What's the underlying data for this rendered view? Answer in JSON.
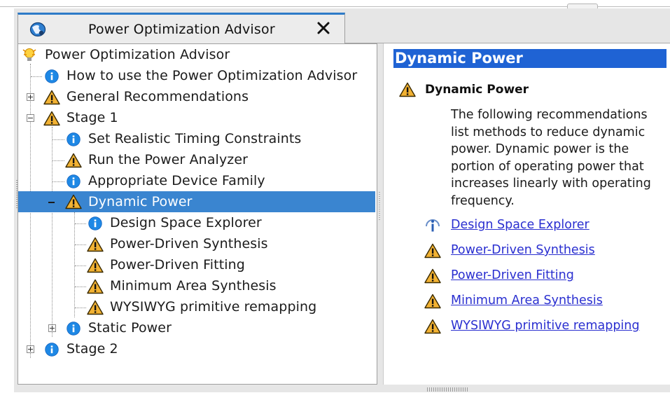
{
  "tab": {
    "title": "Power Optimization Advisor",
    "icon": "advisor-globe-icon",
    "close_icon": "close-x-icon"
  },
  "tree": {
    "items": [
      {
        "label": "Power Optimization Advisor",
        "icon": "lightbulb-icon",
        "expander": "none"
      },
      {
        "label": "How to use the Power Optimization Advisor",
        "icon": "info-icon",
        "expander": "none"
      },
      {
        "label": "General Recommendations",
        "icon": "warning-icon",
        "expander": "plus"
      },
      {
        "label": "Stage 1",
        "icon": "warning-icon",
        "expander": "minus"
      },
      {
        "label": "Set Realistic Timing Constraints",
        "icon": "info-icon",
        "expander": "none"
      },
      {
        "label": "Run the Power Analyzer",
        "icon": "warning-icon",
        "expander": "none"
      },
      {
        "label": "Appropriate Device Family",
        "icon": "info-icon",
        "expander": "none"
      },
      {
        "label": "Dynamic Power",
        "icon": "warning-icon",
        "expander": "minus",
        "selected": true
      },
      {
        "label": "Design Space Explorer",
        "icon": "info-icon",
        "expander": "none"
      },
      {
        "label": "Power-Driven Synthesis",
        "icon": "warning-icon",
        "expander": "none"
      },
      {
        "label": "Power-Driven Fitting",
        "icon": "warning-icon",
        "expander": "none"
      },
      {
        "label": "Minimum Area Synthesis",
        "icon": "warning-icon",
        "expander": "none"
      },
      {
        "label": "WYSIWYG primitive remapping",
        "icon": "warning-icon",
        "expander": "none"
      },
      {
        "label": "Static Power",
        "icon": "info-icon",
        "expander": "plus"
      },
      {
        "label": "Stage 2",
        "icon": "info-icon",
        "expander": "plus"
      }
    ]
  },
  "content": {
    "header": "Dynamic Power",
    "title": "Dynamic Power",
    "description": "The following recommendations list methods to reduce dynamic power. Dynamic power is the portion of operating power that increases linearly with operating frequency.",
    "links": [
      {
        "label": "Design Space Explorer",
        "icon": "info-icon"
      },
      {
        "label": "Power-Driven Synthesis",
        "icon": "warning-icon"
      },
      {
        "label": "Power-Driven Fitting",
        "icon": "warning-icon"
      },
      {
        "label": "Minimum Area Synthesis",
        "icon": "warning-icon"
      },
      {
        "label": "WYSIWYG primitive remapping",
        "icon": "warning-icon"
      }
    ]
  },
  "colors": {
    "accent": "#3a85d0",
    "header_blue": "#1f63d4",
    "link": "#2a2fd0",
    "warning": "#f2b233",
    "info": "#1e88e5"
  }
}
